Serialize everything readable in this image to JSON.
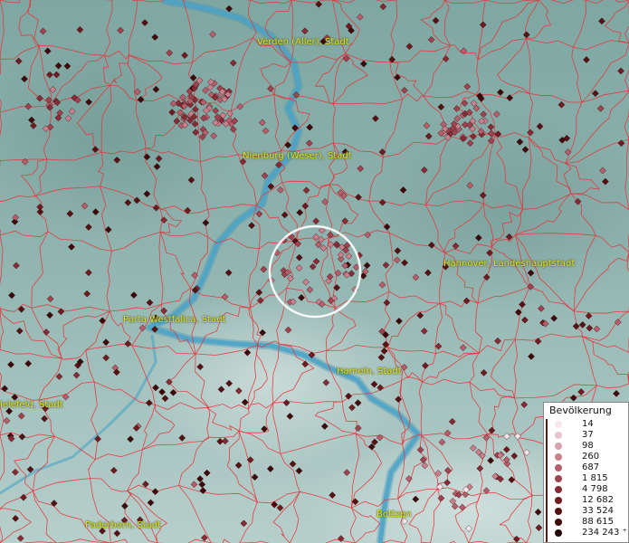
{
  "cities": [
    {
      "name": "Verden (Aller), Stadt"
    },
    {
      "name": "Nienburg (Weser), Stadt"
    },
    {
      "name": "Hannover, Landeshauptstadt"
    },
    {
      "name": "Porta Westfalica, Stadt"
    },
    {
      "name": "Hameln, Stadt"
    },
    {
      "name": "ielefeld, Stadt"
    },
    {
      "name": "Paderborn, Stadt"
    },
    {
      "name": "Bottzen"
    }
  ],
  "legend": {
    "title": "Bevölkerung",
    "classes": [
      {
        "label": "14",
        "color": "#f7e6ee"
      },
      {
        "label": "37",
        "color": "#e9c4cf"
      },
      {
        "label": "98",
        "color": "#d9a0ae"
      },
      {
        "label": "260",
        "color": "#c97f8c"
      },
      {
        "label": "687",
        "color": "#b65e6c"
      },
      {
        "label": "1 815",
        "color": "#a0424f"
      },
      {
        "label": "4 798",
        "color": "#872c36"
      },
      {
        "label": "12 682",
        "color": "#6e1c22"
      },
      {
        "label": "33 524",
        "color": "#561114"
      },
      {
        "label": "88 615",
        "color": "#3d090b"
      },
      {
        "label": "234 243 ⁺",
        "color": "#220304"
      }
    ]
  },
  "colors": {
    "river": "#4aa3c8",
    "boundaries": "#e8323a",
    "city_label": "#e8e61c",
    "highlight_circle": "#ffffff"
  },
  "symbol": "diamond-point-marker"
}
